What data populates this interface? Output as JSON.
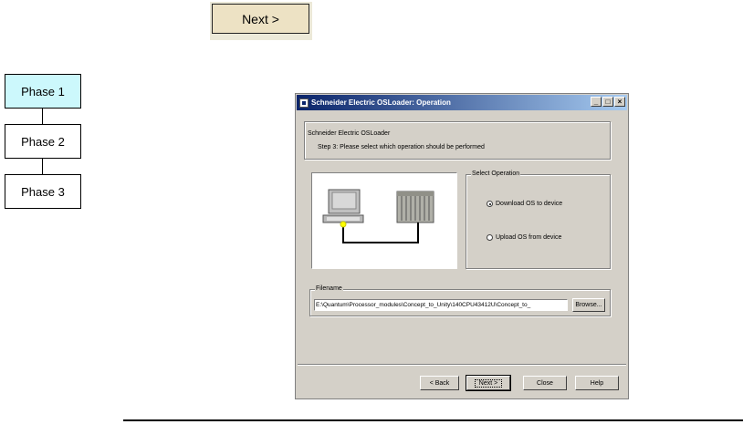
{
  "top_button": {
    "label": "Next >"
  },
  "phases": [
    {
      "label": "Phase 1",
      "active": true
    },
    {
      "label": "Phase 2",
      "active": false
    },
    {
      "label": "Phase 3",
      "active": false
    }
  ],
  "dialog": {
    "title": "Schneider Electric OSLoader: Operation",
    "titlebar_buttons": {
      "minimize": "_",
      "maximize": "□",
      "close": "×"
    },
    "header": {
      "app_name": "Schneider Electric OSLoader",
      "step_text": "Step 3: Please select which operation should be performed"
    },
    "select_operation": {
      "legend": "Select Operation",
      "options": [
        {
          "label": "Download OS to device",
          "selected": true
        },
        {
          "label": "Upload OS from device",
          "selected": false
        }
      ]
    },
    "filename": {
      "legend": "Filename",
      "value": "E:\\Quantum\\Processor_modules\\Concept_to_Unity\\140CPU43412U\\Concept_to_",
      "browse_label": "Browse..."
    },
    "buttons": {
      "back": "< Back",
      "next": "Next >",
      "close": "Close",
      "help": "Help"
    }
  },
  "colors": {
    "phase_active": "#ccf8fc",
    "dialog_face": "#d4d0c8",
    "title_start": "#0a246a",
    "title_end": "#a6caf0"
  }
}
